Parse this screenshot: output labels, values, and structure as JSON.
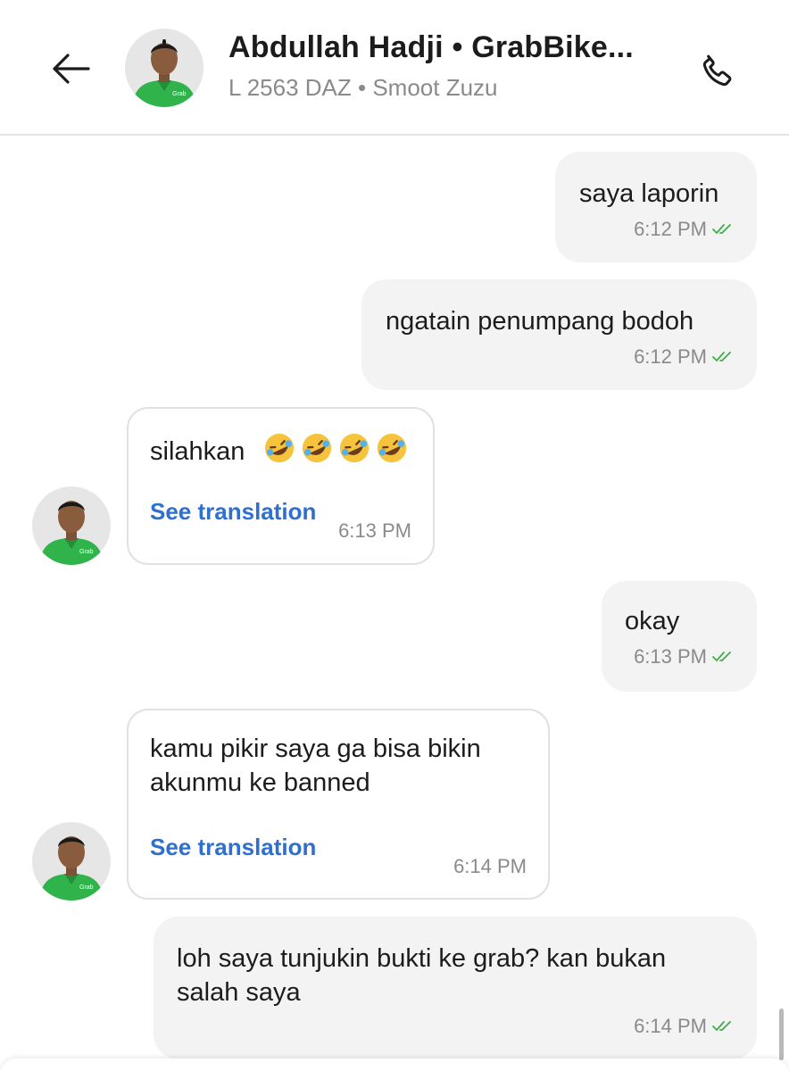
{
  "header": {
    "back_icon": "arrow-left-icon",
    "name": "Abdullah Hadji • GrabBike...",
    "subtitle": "L 2563 DAZ • Smoot Zuzu",
    "call_icon": "phone-icon",
    "avatar_icon": "driver-avatar"
  },
  "colors": {
    "outgoing_bubble": "#f3f3f3",
    "incoming_border": "#e1e1e1",
    "link": "#2f6fce",
    "tick": "#3fae49",
    "driver_jacket": "#2fb34a"
  },
  "messages": [
    {
      "direction": "out",
      "text": "saya laporin",
      "time": "6:12 PM",
      "status_icon": "double-check-icon"
    },
    {
      "direction": "out",
      "text": "ngatain penumpang bodoh",
      "time": "6:12 PM",
      "status_icon": "double-check-icon"
    },
    {
      "direction": "in",
      "text": "silahkan",
      "emoji": "rolling-on-floor-laughing-emoji",
      "emoji_count": 4,
      "translate_label": "See translation",
      "time": "6:13 PM"
    },
    {
      "direction": "out",
      "text": "okay",
      "time": "6:13 PM",
      "status_icon": "double-check-icon"
    },
    {
      "direction": "in",
      "text_lines": [
        "kamu pikir saya ga bisa bikin",
        "akunmu ke banned"
      ],
      "translate_label": "See translation",
      "time": "6:14 PM"
    },
    {
      "direction": "out",
      "text_lines": [
        "loh saya tunjukin bukti ke grab? kan bukan",
        "salah saya"
      ],
      "time": "6:14 PM",
      "status_icon": "double-check-icon"
    }
  ]
}
